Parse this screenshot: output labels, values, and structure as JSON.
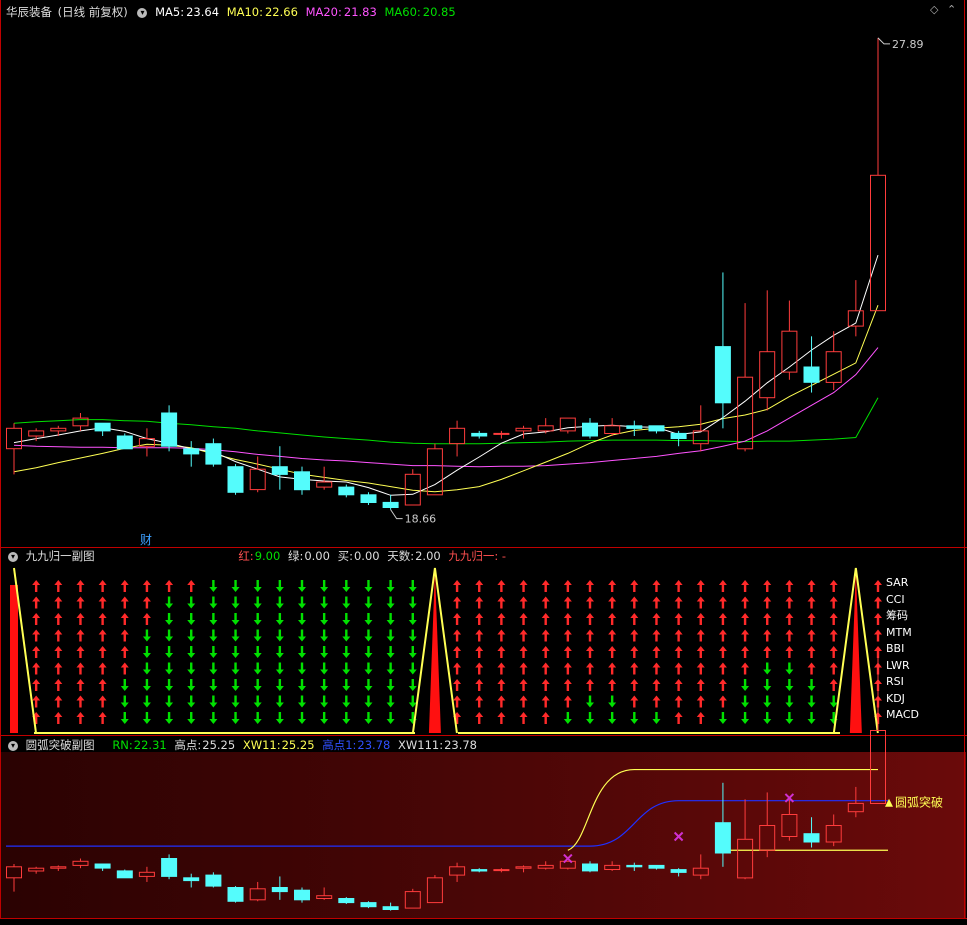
{
  "main": {
    "title": "华辰装备",
    "mode": "(日线 前复权)",
    "ma5_label": "MA5:",
    "ma5": "23.64",
    "ma10_label": "MA10:",
    "ma10": "22.66",
    "ma20_label": "MA20:",
    "ma20": "21.83",
    "ma60_label": "MA60:",
    "ma60": "20.85",
    "high_label": "27.89",
    "low_label": "18.66",
    "fin_badge": "财"
  },
  "sub1": {
    "title": "九九归一副图",
    "red_label": "红:",
    "red": "9.00",
    "green_label": "绿:",
    "green": "0.00",
    "buy_label": "买:",
    "buy": "0.00",
    "days_label": "天数:",
    "days": "2.00",
    "tail": "九九归一: -",
    "indicators": [
      "SAR",
      "CCI",
      "筹码",
      "MTM",
      "BBI",
      "LWR",
      "RSI",
      "KDJ",
      "MACD"
    ]
  },
  "sub2": {
    "title": "圆弧突破副图",
    "rn_label": "RN:",
    "rn": "22.31",
    "hp_label": "高点:",
    "hp": "25.25",
    "xw11_label": "XW11:",
    "xw11": "25.25",
    "hp1_label": "高点1:",
    "hp1": "23.78",
    "xw111_label": "XW111:",
    "xw111": "23.78",
    "breakout_label": "圆弧突破"
  },
  "colors": {
    "up": "#ff3c3c",
    "down": "#54fcfc",
    "ma5": "#ffffff",
    "ma10": "#ffff54",
    "ma20": "#ff54ff",
    "ma60": "#00e000",
    "axis": "#c00000"
  },
  "chart_data": {
    "type": "candlestick",
    "ohlc": [
      [
        19.85,
        20.25,
        19.35,
        20.35
      ],
      [
        20.1,
        20.2,
        20.0,
        20.25
      ],
      [
        20.2,
        20.25,
        20.1,
        20.3
      ],
      [
        20.3,
        20.45,
        20.2,
        20.55
      ],
      [
        20.35,
        20.2,
        20.1,
        20.35
      ],
      [
        20.1,
        19.85,
        19.85,
        20.15
      ],
      [
        19.9,
        20.05,
        19.7,
        20.25
      ],
      [
        20.55,
        19.9,
        19.8,
        20.7
      ],
      [
        19.85,
        19.75,
        19.5,
        20.0
      ],
      [
        19.95,
        19.55,
        19.5,
        20.05
      ],
      [
        19.5,
        19.0,
        18.95,
        19.55
      ],
      [
        19.05,
        19.45,
        19.0,
        19.7
      ],
      [
        19.5,
        19.35,
        19.05,
        19.9
      ],
      [
        19.4,
        19.05,
        18.95,
        19.5
      ],
      [
        19.1,
        19.2,
        19.05,
        19.5
      ],
      [
        19.1,
        18.95,
        18.9,
        19.15
      ],
      [
        18.95,
        18.8,
        18.75,
        19.0
      ],
      [
        18.8,
        18.7,
        18.66,
        18.95
      ],
      [
        18.75,
        19.35,
        18.75,
        19.45
      ],
      [
        18.95,
        19.85,
        18.95,
        19.95
      ],
      [
        19.95,
        20.25,
        19.7,
        20.4
      ],
      [
        20.15,
        20.1,
        20.05,
        20.2
      ],
      [
        20.15,
        20.15,
        20.05,
        20.2
      ],
      [
        20.2,
        20.25,
        20.05,
        20.3
      ],
      [
        20.2,
        20.3,
        20.15,
        20.45
      ],
      [
        20.2,
        20.45,
        20.15,
        20.45
      ],
      [
        20.35,
        20.1,
        20.05,
        20.45
      ],
      [
        20.15,
        20.3,
        20.1,
        20.45
      ],
      [
        20.3,
        20.25,
        20.1,
        20.4
      ],
      [
        20.3,
        20.2,
        20.15,
        20.3
      ],
      [
        20.15,
        20.05,
        19.9,
        20.2
      ],
      [
        19.95,
        20.2,
        19.8,
        20.7
      ],
      [
        21.85,
        20.75,
        20.25,
        23.3
      ],
      [
        19.85,
        21.25,
        19.8,
        22.7
      ],
      [
        20.85,
        21.75,
        20.6,
        22.95
      ],
      [
        21.35,
        22.15,
        21.2,
        22.75
      ],
      [
        21.45,
        21.15,
        20.95,
        22.05
      ],
      [
        21.15,
        21.75,
        21.0,
        22.15
      ],
      [
        22.25,
        22.55,
        22.05,
        23.15
      ],
      [
        22.55,
        25.2,
        22.55,
        27.89
      ]
    ],
    "ma5": [
      19.97,
      20.05,
      20.12,
      20.2,
      20.26,
      20.19,
      20.05,
      19.96,
      19.85,
      19.79,
      19.6,
      19.45,
      19.3,
      19.25,
      19.22,
      19.2,
      19.09,
      18.94,
      18.96,
      19.15,
      19.43,
      19.69,
      19.96,
      20.14,
      20.18,
      20.26,
      20.29,
      20.31,
      20.28,
      20.27,
      20.13,
      20.18,
      20.46,
      20.78,
      21.14,
      21.45,
      21.78,
      22.07,
      22.31,
      23.64
    ],
    "ma10": [
      19.4,
      19.48,
      19.58,
      19.67,
      19.76,
      19.86,
      19.94,
      19.92,
      19.87,
      19.75,
      19.64,
      19.55,
      19.45,
      19.35,
      19.29,
      19.23,
      19.18,
      19.11,
      19.04,
      19.01,
      19.05,
      19.11,
      19.25,
      19.42,
      19.59,
      19.76,
      19.96,
      20.12,
      20.21,
      20.25,
      20.28,
      20.33,
      20.44,
      20.51,
      20.62,
      20.87,
      21.09,
      21.31,
      21.53,
      22.66
    ],
    "ma20": [
      19.92,
      19.9,
      19.89,
      19.88,
      19.88,
      19.87,
      19.87,
      19.87,
      19.86,
      19.83,
      19.79,
      19.74,
      19.7,
      19.66,
      19.63,
      19.61,
      19.58,
      19.55,
      19.52,
      19.52,
      19.51,
      19.5,
      19.51,
      19.51,
      19.52,
      19.55,
      19.58,
      19.62,
      19.66,
      19.7,
      19.76,
      19.81,
      19.9,
      20.0,
      20.2,
      20.45,
      20.7,
      20.95,
      21.3,
      21.83
    ],
    "ma60": [
      20.35,
      20.38,
      20.4,
      20.42,
      20.42,
      20.4,
      20.39,
      20.35,
      20.32,
      20.28,
      20.25,
      20.2,
      20.16,
      20.12,
      20.08,
      20.05,
      20.02,
      19.98,
      19.96,
      19.95,
      19.95,
      19.95,
      19.96,
      19.97,
      19.98,
      20.0,
      20.01,
      20.02,
      20.02,
      20.02,
      20.01,
      20.01,
      20.0,
      19.99,
      20.0,
      20.0,
      20.02,
      20.04,
      20.07,
      20.85
    ],
    "ylim": [
      18.3,
      28.2
    ],
    "sub2_ylim": [
      18.5,
      24.2
    ],
    "sub2_lines": {
      "yellow_level": 20.85,
      "yellow_high": 23.78,
      "blue_level": 21.0,
      "blue_high": 22.65
    }
  }
}
